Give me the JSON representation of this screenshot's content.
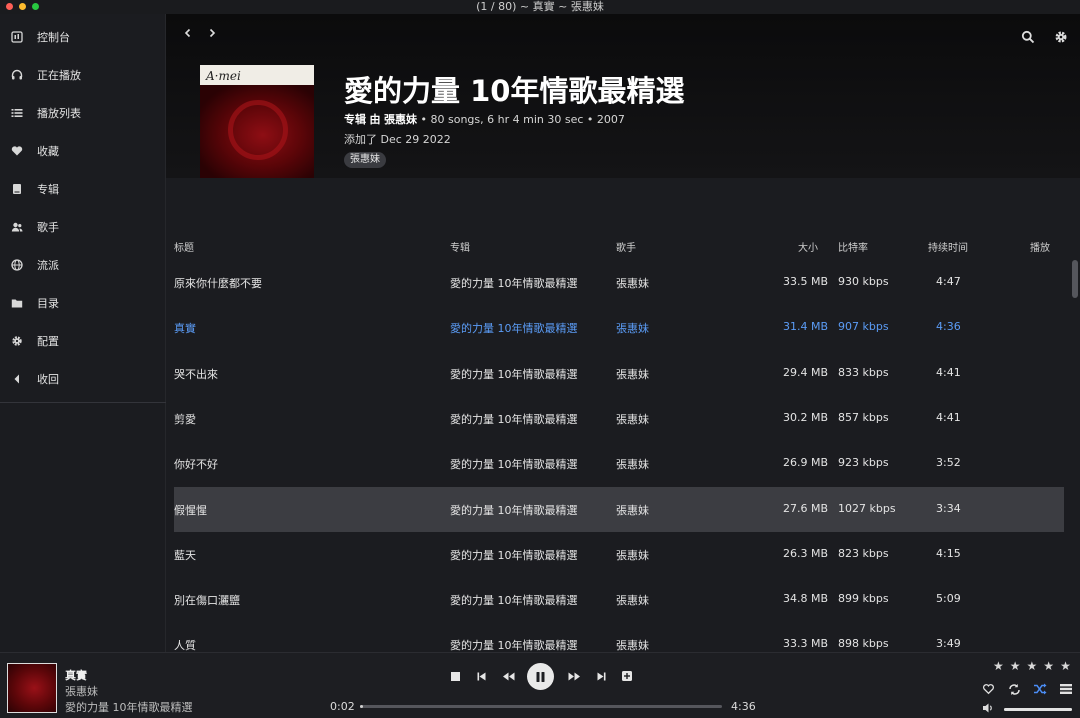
{
  "window": {
    "title": "(1 / 80) ~ 真實 ~ 張惠妹",
    "traffic_lights": [
      "#fe5f57",
      "#febc2e",
      "#28c840"
    ]
  },
  "sidebar": {
    "items": [
      {
        "label": "控制台",
        "icon": "dashboard-icon"
      },
      {
        "label": "正在播放",
        "icon": "headphones-icon"
      },
      {
        "label": "播放列表",
        "icon": "list-icon"
      },
      {
        "label": "收藏",
        "icon": "heart-icon"
      },
      {
        "label": "专辑",
        "icon": "album-icon"
      },
      {
        "label": "歌手",
        "icon": "artists-icon"
      },
      {
        "label": "流派",
        "icon": "globe-icon"
      },
      {
        "label": "目录",
        "icon": "folder-icon"
      },
      {
        "label": "配置",
        "icon": "gear-icon"
      },
      {
        "label": "收回",
        "icon": "collapse-icon"
      }
    ]
  },
  "header": {
    "back_icon": "chevron-left-icon",
    "forward_icon": "chevron-right-icon",
    "search_icon": "search-icon",
    "settings_icon": "gear-icon"
  },
  "album": {
    "cover_signature": "A·mei",
    "title": "愛的力量 10年情歌最精選",
    "meta_type": "专辑",
    "meta_by": "由",
    "meta_artist": "張惠妹",
    "meta_rest": "• 80 songs, 6 hr 4 min 30 sec • 2007",
    "added": "添加了 Dec 29 2022",
    "genre": "張惠妹",
    "accent_color": "#4c8ef7"
  },
  "actions": [
    "play-icon",
    "add-next-icon",
    "add-icon",
    "heart-icon",
    "download-icon"
  ],
  "table": {
    "columns": {
      "title": "标题",
      "album": "专辑",
      "artist": "歌手",
      "size": "大小",
      "bitrate": "比特率",
      "duration": "持续时间",
      "plays": "播放"
    },
    "rows": [
      {
        "title": "原來你什麼都不要",
        "album": "愛的力量 10年情歌最精選",
        "artist": "張惠妹",
        "size": "33.5 MB",
        "bitrate": "930 kbps",
        "duration": "4:47"
      },
      {
        "title": "真實",
        "album": "愛的力量 10年情歌最精選",
        "artist": "張惠妹",
        "size": "31.4 MB",
        "bitrate": "907 kbps",
        "duration": "4:36"
      },
      {
        "title": "哭不出來",
        "album": "愛的力量 10年情歌最精選",
        "artist": "張惠妹",
        "size": "29.4 MB",
        "bitrate": "833 kbps",
        "duration": "4:41"
      },
      {
        "title": "剪愛",
        "album": "愛的力量 10年情歌最精選",
        "artist": "張惠妹",
        "size": "30.2 MB",
        "bitrate": "857 kbps",
        "duration": "4:41"
      },
      {
        "title": "你好不好",
        "album": "愛的力量 10年情歌最精選",
        "artist": "張惠妹",
        "size": "26.9 MB",
        "bitrate": "923 kbps",
        "duration": "3:52"
      },
      {
        "title": "假惺惺",
        "album": "愛的力量 10年情歌最精選",
        "artist": "張惠妹",
        "size": "27.6 MB",
        "bitrate": "1027 kbps",
        "duration": "3:34"
      },
      {
        "title": "藍天",
        "album": "愛的力量 10年情歌最精選",
        "artist": "張惠妹",
        "size": "26.3 MB",
        "bitrate": "823 kbps",
        "duration": "4:15"
      },
      {
        "title": "別在傷口灑鹽",
        "album": "愛的力量 10年情歌最精選",
        "artist": "張惠妹",
        "size": "34.8 MB",
        "bitrate": "899 kbps",
        "duration": "5:09"
      },
      {
        "title": "人質",
        "album": "愛的力量 10年情歌最精選",
        "artist": "張惠妹",
        "size": "33.3 MB",
        "bitrate": "898 kbps",
        "duration": "3:49"
      }
    ],
    "playing_row": 1,
    "selected_row": 5,
    "playing_color": "#5b9cf6"
  },
  "player": {
    "title": "真實",
    "artist": "張惠妹",
    "album": "愛的力量 10年情歌最精選",
    "elapsed": "0:02",
    "total": "4:36",
    "progress": 0.007,
    "volume": 1.0,
    "rating": 0,
    "max_rating": 5,
    "shuffle_color": "#4c8ef7"
  }
}
